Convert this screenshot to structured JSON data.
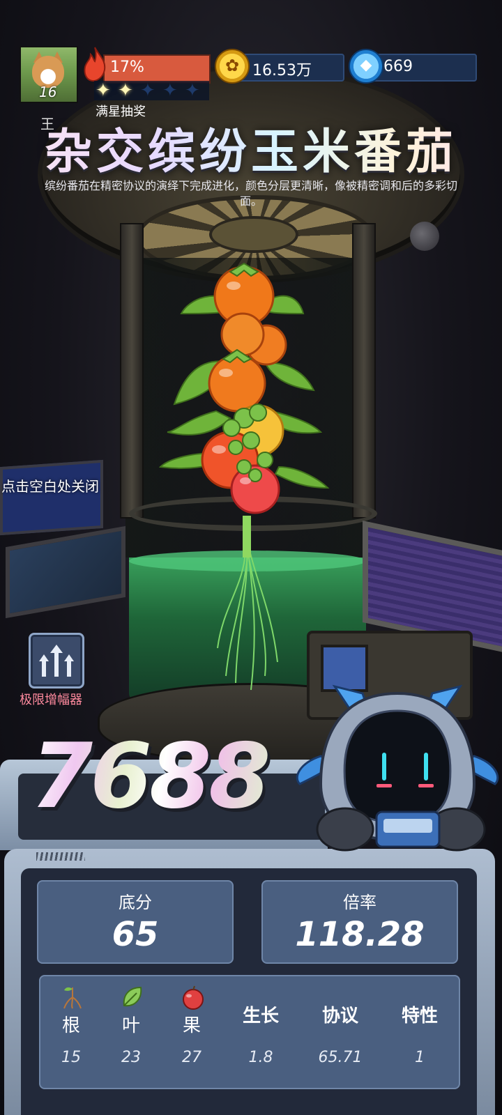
{
  "player": {
    "level": "16",
    "heat_percent": "17%",
    "stars_filled": 2,
    "stars_total": 5,
    "full_star_lottery": "满星抽奖"
  },
  "currency": {
    "coins": "16.53万",
    "gems": "669"
  },
  "item": {
    "rank_mark": "王",
    "title": "杂交缤纷玉米番茄",
    "description": "缤纷番茄在精密协议的演绎下完成进化，颜色分层更清晰，像被精密调和后的多彩切面。"
  },
  "hints": {
    "close": "点击空白处关闭"
  },
  "amplifier": {
    "label": "极限增幅器",
    "icon": "triple-up-arrow-icon"
  },
  "score": {
    "total": "7688",
    "base_label": "底分",
    "base_value": "65",
    "multiplier_label": "倍率",
    "multiplier_value": "118.28"
  },
  "stats": [
    {
      "label": "根",
      "value": "15",
      "icon": "root-icon"
    },
    {
      "label": "叶",
      "value": "23",
      "icon": "leaf-icon"
    },
    {
      "label": "果",
      "value": "27",
      "icon": "apple-icon"
    },
    {
      "label": "生长",
      "value": "1.8"
    },
    {
      "label": "协议",
      "value": "65.71"
    },
    {
      "label": "特性",
      "value": "1"
    }
  ],
  "colors": {
    "heat_bar": "#d85a3e",
    "panel": "#4a5f80",
    "accent_pink": "#ff8a9e",
    "liquid": "#3aa65e"
  }
}
